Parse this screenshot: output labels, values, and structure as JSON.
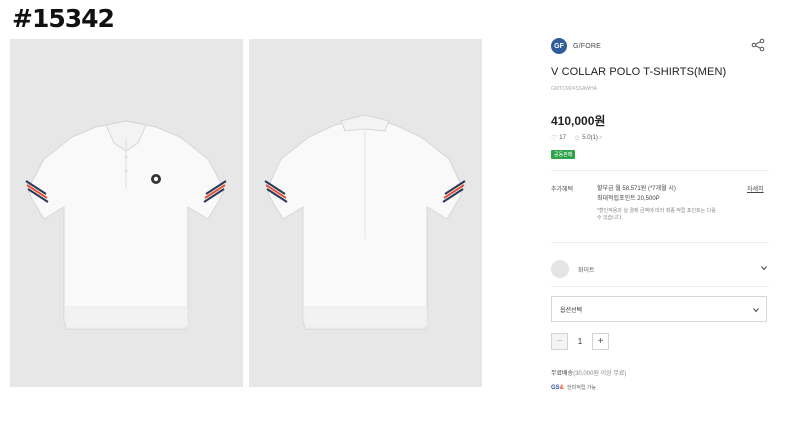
{
  "page_code": "#15342",
  "brand": {
    "logo_text": "GF",
    "name": "G/FORE"
  },
  "product": {
    "title": "V COLLAR POLO T-SHIRTS(MEN)",
    "sku": "GMTCM24SSAWHA",
    "price": "410,000원",
    "likes": "17",
    "rating": "5.0(1)",
    "badge": "공동판매"
  },
  "benefit": {
    "label": "추가혜택",
    "installment": "할부금 월 58,571원 (*7개월 시)",
    "points": "최대적립포인트 20,500P",
    "note": "*할인적용과 실 결제 금액에 따라 최종 적립 포인트는 다를 수 있습니다.",
    "detail_link": "자세히"
  },
  "color_option": {
    "label": "화이트"
  },
  "option_select": {
    "placeholder": "옵션선택"
  },
  "quantity": {
    "minus": "−",
    "value": "1",
    "plus": "+"
  },
  "shipping": {
    "label": "무료배송",
    "condition": "(30,000원 이상 무료)"
  },
  "points_info": {
    "logo_a": "GS",
    "logo_b": "&",
    "text": "한미적립 가능"
  },
  "colors": {
    "accent_green": "#2ea34a",
    "brand_blue": "#2f5d9c",
    "stripe_navy": "#2c3a5a",
    "stripe_red": "#e0553b"
  }
}
